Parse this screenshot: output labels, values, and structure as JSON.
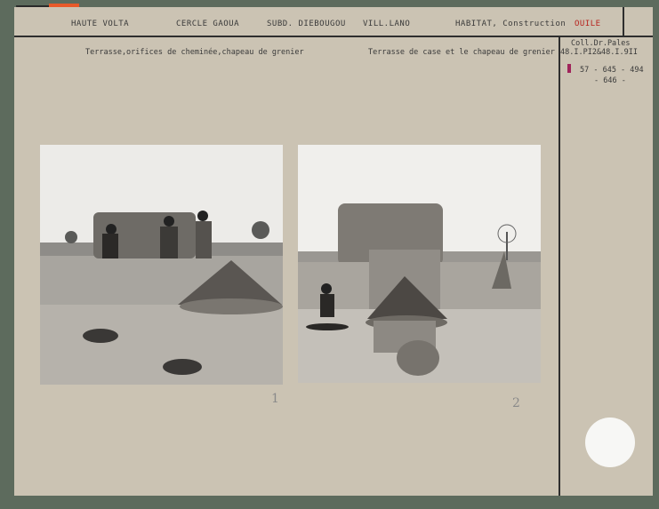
{
  "header": {
    "region": "HAUTE VOLTA",
    "cercle": "CERCLE GAOUA",
    "subdivision": "SUBD. DIEBOUGOU",
    "village": "VILL.LANO",
    "subject": "HABITAT, Construction",
    "people": "OUILE"
  },
  "captions": {
    "left": "Terrasse,orifices de cheminée,chapeau de grenier",
    "right": "Terrasse de case et le chapeau de grenier"
  },
  "references": {
    "collection": "Coll.Dr.Pales",
    "inventory": "48.I.PI2&48.I.9II",
    "numbers_line1": "57 - 645 - 494",
    "numbers_line2": "- 646 -"
  },
  "photo_numbers": [
    "1",
    "2"
  ],
  "colors": {
    "card": "#cbc3b3",
    "background": "#5d6b5d",
    "accent_red": "#b7241e"
  }
}
